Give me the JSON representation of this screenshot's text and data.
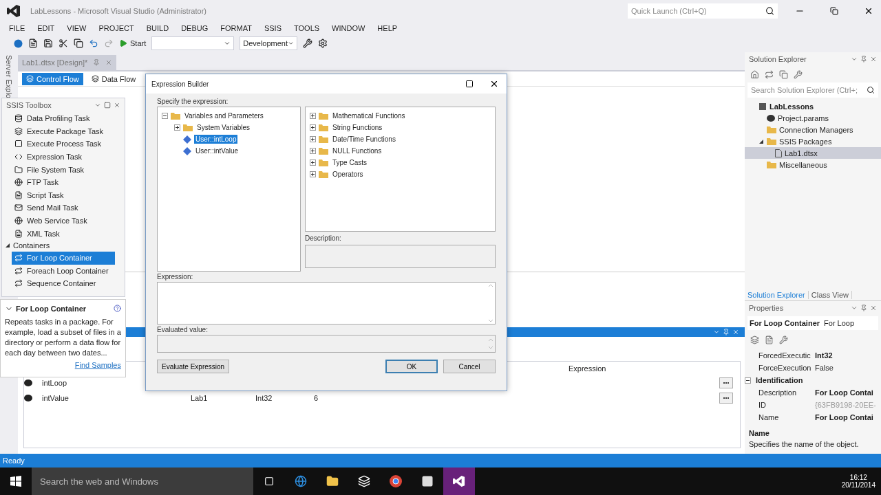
{
  "window": {
    "title": "LabLessons - Microsoft Visual Studio (Administrator)",
    "quick_launch": {
      "placeholder": "Quick Launch (Ctrl+Q)"
    }
  },
  "menu": [
    "FILE",
    "EDIT",
    "VIEW",
    "PROJECT",
    "BUILD",
    "DEBUG",
    "FORMAT",
    "SSIS",
    "TOOLS",
    "WINDOW",
    "HELP"
  ],
  "toolbar": {
    "start": "Start",
    "configuration": "Development"
  },
  "side_strip": "Server Explo",
  "document_tab": {
    "label": "Lab1.dtsx [Design]*"
  },
  "designer_tabs": [
    {
      "label": "Control Flow",
      "selected": true
    },
    {
      "label": "Data Flow",
      "selected": false
    }
  ],
  "toolbox": {
    "title": "SSIS Toolbox",
    "items": [
      {
        "label": "Data Profiling Task",
        "selected": false
      },
      {
        "label": "Execute Package Task",
        "selected": false
      },
      {
        "label": "Execute Process Task",
        "selected": false
      },
      {
        "label": "Expression Task",
        "selected": false
      },
      {
        "label": "File System Task",
        "selected": false
      },
      {
        "label": "FTP Task",
        "selected": false
      },
      {
        "label": "Script Task",
        "selected": false
      },
      {
        "label": "Send Mail Task",
        "selected": false
      },
      {
        "label": "Web Service Task",
        "selected": false
      },
      {
        "label": "XML Task",
        "selected": false
      }
    ],
    "group": {
      "label": "Containers",
      "expanded": true,
      "items": [
        {
          "label": "For Loop Container",
          "selected": true
        },
        {
          "label": "Foreach Loop Container",
          "selected": false
        },
        {
          "label": "Sequence Container",
          "selected": false
        }
      ]
    }
  },
  "toolbox_help": {
    "title": "For Loop Container",
    "text": "Repeats tasks in a package. For example, load a subset of files in a directory or perform a data flow for each day between two dates...",
    "link": "Find Samples"
  },
  "variables": {
    "columns": [
      "Expression"
    ],
    "rows": [
      {
        "cells": [
          "intLoop"
        ]
      },
      {
        "cells": [
          "intValue",
          "Lab1",
          "Int32",
          "6"
        ]
      }
    ]
  },
  "dialog": {
    "title": "Expression Builder",
    "label": "Specify the expression:",
    "variables_tree": [
      {
        "label": "Variables and Parameters",
        "kind": "folder",
        "expanded": true,
        "selected": false,
        "children": [
          {
            "label": "System Variables",
            "kind": "folder",
            "expanded": false,
            "selected": false
          },
          {
            "label": "User::intLoop",
            "kind": "variable",
            "selected": true
          },
          {
            "label": "User::intValue",
            "kind": "variable",
            "selected": false
          }
        ]
      }
    ],
    "functions_tree": [
      {
        "label": "Mathematical Functions",
        "kind": "folder",
        "expanded": false,
        "selected": false
      },
      {
        "label": "String Functions",
        "kind": "folder",
        "expanded": false,
        "selected": false
      },
      {
        "label": "Date/Time Functions",
        "kind": "folder",
        "expanded": false,
        "selected": false
      },
      {
        "label": "NULL Functions",
        "kind": "folder",
        "expanded": false,
        "selected": false
      },
      {
        "label": "Type Casts",
        "kind": "folder",
        "expanded": false,
        "selected": false
      },
      {
        "label": "Operators",
        "kind": "folder",
        "expanded": false,
        "selected": false
      }
    ],
    "description_label": "Description:",
    "expression_label": "Expression:",
    "evaluated_label": "Evaluated value:",
    "buttons": [
      {
        "label": "Evaluate Expression",
        "kind": "plain"
      },
      {
        "label": "OK",
        "kind": "default"
      },
      {
        "label": "Cancel",
        "kind": "plain"
      }
    ]
  },
  "solution_explorer": {
    "title": "Solution Explorer",
    "search": {
      "placeholder": "Search Solution Explorer (Ctrl+;"
    },
    "tree": [
      {
        "label": "LabLessons",
        "kind": "solution",
        "selected": false,
        "children": [
          {
            "label": "Project.params",
            "kind": "item",
            "selected": false
          },
          {
            "label": "Connection Managers",
            "kind": "folder",
            "selected": false
          },
          {
            "label": "SSIS Packages",
            "kind": "folder",
            "expanded": true,
            "selected": false,
            "children": [
              {
                "label": "Lab1.dtsx",
                "kind": "package",
                "selected": true
              }
            ]
          },
          {
            "label": "Miscellaneous",
            "kind": "folder",
            "selected": false
          }
        ]
      }
    ],
    "tabs": [
      {
        "label": "Solution Explorer",
        "selected": true
      },
      {
        "label": "Class View",
        "selected": false
      }
    ]
  },
  "properties": {
    "title": "Properties",
    "object": {
      "name": "For Loop Container",
      "type": "For Loop"
    },
    "rows": [
      {
        "kind": "property",
        "name": "ForcedExecutic",
        "value": "Int32",
        "modified": true,
        "readonly": false
      },
      {
        "kind": "property",
        "name": "ForceExecution",
        "value": "False",
        "modified": false,
        "readonly": false
      },
      {
        "kind": "category",
        "name": "Identification",
        "expanded": true
      },
      {
        "kind": "property",
        "name": "Description",
        "value": "For Loop Contai",
        "modified": true,
        "readonly": false
      },
      {
        "kind": "property",
        "name": "ID",
        "value": "{63FB9198-20EE-",
        "modified": false,
        "readonly": true
      },
      {
        "kind": "property",
        "name": "Name",
        "value": "For Loop Contai",
        "modified": true,
        "readonly": false
      }
    ],
    "help": {
      "title": "Name",
      "text": "Specifies the name of the object."
    }
  },
  "status_bar": "Ready",
  "taskbar": {
    "search": {
      "placeholder": "Search the web and Windows"
    },
    "time": "16:12",
    "date": "20/11/2014"
  }
}
